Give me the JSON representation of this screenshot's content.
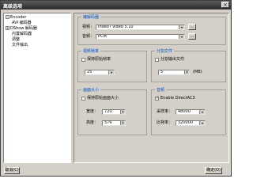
{
  "window": {
    "title": "高级选项",
    "close_glyph": "×"
  },
  "tree": {
    "root": "Encoder",
    "items": [
      "AVI 编码器",
      "DShow 解码器",
      "内置解码器",
      "调整",
      "文件输出"
    ]
  },
  "encoder_group": {
    "title": "编解码器",
    "video_label": "视频：",
    "video_value": "Indeo? video 5.10",
    "audio_label": "音频：",
    "audio_value": "PCM"
  },
  "framerate_group": {
    "title": "视频帧率",
    "keep_original_label": "保持原始帧率",
    "value": "25"
  },
  "split_group": {
    "title": "分割文件",
    "split_label": "分割输出文件",
    "value": "5",
    "unit": "(MB)"
  },
  "size_group": {
    "title": "画面大小",
    "keep_original_label": "保持原始画面大小",
    "width_label": "宽度：",
    "width_value": "720",
    "height_label": "高度：",
    "height_value": "576"
  },
  "audio_group": {
    "title": "音频",
    "directac3_label": "Enable DirectAC3",
    "samplerate_label": "采样率：",
    "samplerate_value": "48000",
    "bitrate_label": "比特率：",
    "bitrate_value": "320000"
  },
  "buttons": {
    "cancel": "取消(C)",
    "ok": "确定(O)"
  }
}
